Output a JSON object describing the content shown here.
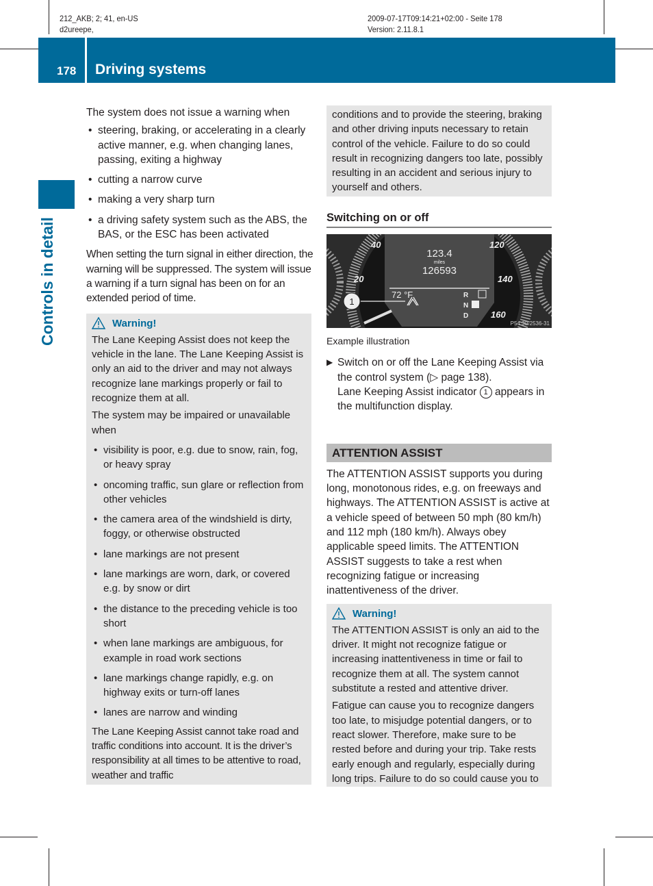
{
  "meta": {
    "left_line1": "212_AKB; 2; 41, en-US",
    "left_line2": "d2ureepe,",
    "right_line1": "2009-07-17T09:14:21+02:00 - Seite 178",
    "right_line2": "Version: 2.11.8.1"
  },
  "header": {
    "page_number": "178",
    "title": "Driving systems",
    "color": "#006a9a"
  },
  "side_tab": {
    "label": "Controls in detail"
  },
  "left_column": {
    "intro": "The system does not issue a warning when",
    "bullets": [
      "steering, braking, or accelerating in a clearly active manner, e.g. when changing lanes, passing, exiting a highway",
      "cutting a narrow curve",
      "making a very sharp turn",
      "a driving safety system such as the ABS, the BAS, or the ESC has been activated"
    ],
    "turn_signal_text": "When setting the turn signal in either direction, the warning will be suppressed. The system will issue a warning if a turn signal has been on for an extended period of time.",
    "warning": {
      "icon": "warning-triangle-icon",
      "title": "Warning!",
      "para1": "The Lane Keeping Assist does not keep the vehicle in the lane. The Lane Keeping Assist is only an aid to the driver and may not always recognize lane markings properly or fail to recognize them at all.",
      "para2": "The system may be impaired or unavailable when",
      "bullets": [
        "visibility is poor, e.g. due to snow, rain, fog, or heavy spray",
        "oncoming traffic, sun glare or reflection from other vehicles",
        "the camera area of the windshield is dirty, foggy, or otherwise obstructed",
        "lane markings are not present",
        "lane markings are worn, dark, or covered e.g. by snow or dirt",
        "the distance to the preceding vehicle is too short",
        "when lane markings are ambiguous, for example in road work sections",
        "lane markings change rapidly, e.g. on highway exits or turn-off lanes",
        "lanes are narrow and winding"
      ],
      "para3": "The Lane Keeping Assist cannot take road and traffic conditions into account. It is the driver’s responsibility at all times to be attentive to road, weather and traffic"
    }
  },
  "right_column": {
    "warning_continued": "conditions and to provide the steering, braking and other driving inputs necessary to retain control of the vehicle. Failure to do so could result in recognizing dangers too late, possibly resulting in an accident and serious injury to yourself and others.",
    "switching_heading": "Switching on or off",
    "illustration": {
      "trip": "123.4",
      "unit": "miles",
      "odometer": "126593",
      "temperature": "72 °F",
      "gears": [
        "R",
        "N",
        "D"
      ],
      "speed_left": [
        "40",
        "20"
      ],
      "speed_right": [
        "120",
        "140",
        "160"
      ],
      "callout": "1",
      "ref_code": "P54.30-2536-31"
    },
    "caption": "Example illustration",
    "step_line1": "Switch on or off the Lane Keeping Assist via the control system (▷ page 138).",
    "step_line2_pre": "Lane Keeping Assist indicator",
    "step_callout": "1",
    "step_line2_post": "appears in the multifunction display.",
    "attention_heading": "ATTENTION ASSIST",
    "attention_text": "The ATTENTION ASSIST supports you during long, monotonous rides, e.g. on freeways and highways. The ATTENTION ASSIST is active at a vehicle speed of between 50 mph (80 km/h) and 112 mph (180 km/h). Always obey applicable speed limits. The ATTENTION ASSIST suggests to take a rest when recognizing fatigue or increasing inattentiveness of the driver.",
    "warning2": {
      "title": "Warning!",
      "para1": "The ATTENTION ASSIST is only an aid to the driver. It might not recognize fatigue or increasing inattentiveness in time or fail to recognize them at all. The system cannot substitute a rested and attentive driver.",
      "para2": "Fatigue can cause you to recognize dangers too late, to misjudge potential dangers, or to react slower. Therefore, make sure to be rested before and during your trip. Take rests early enough and regularly, especially during long trips. Failure to do so could cause you to"
    }
  }
}
